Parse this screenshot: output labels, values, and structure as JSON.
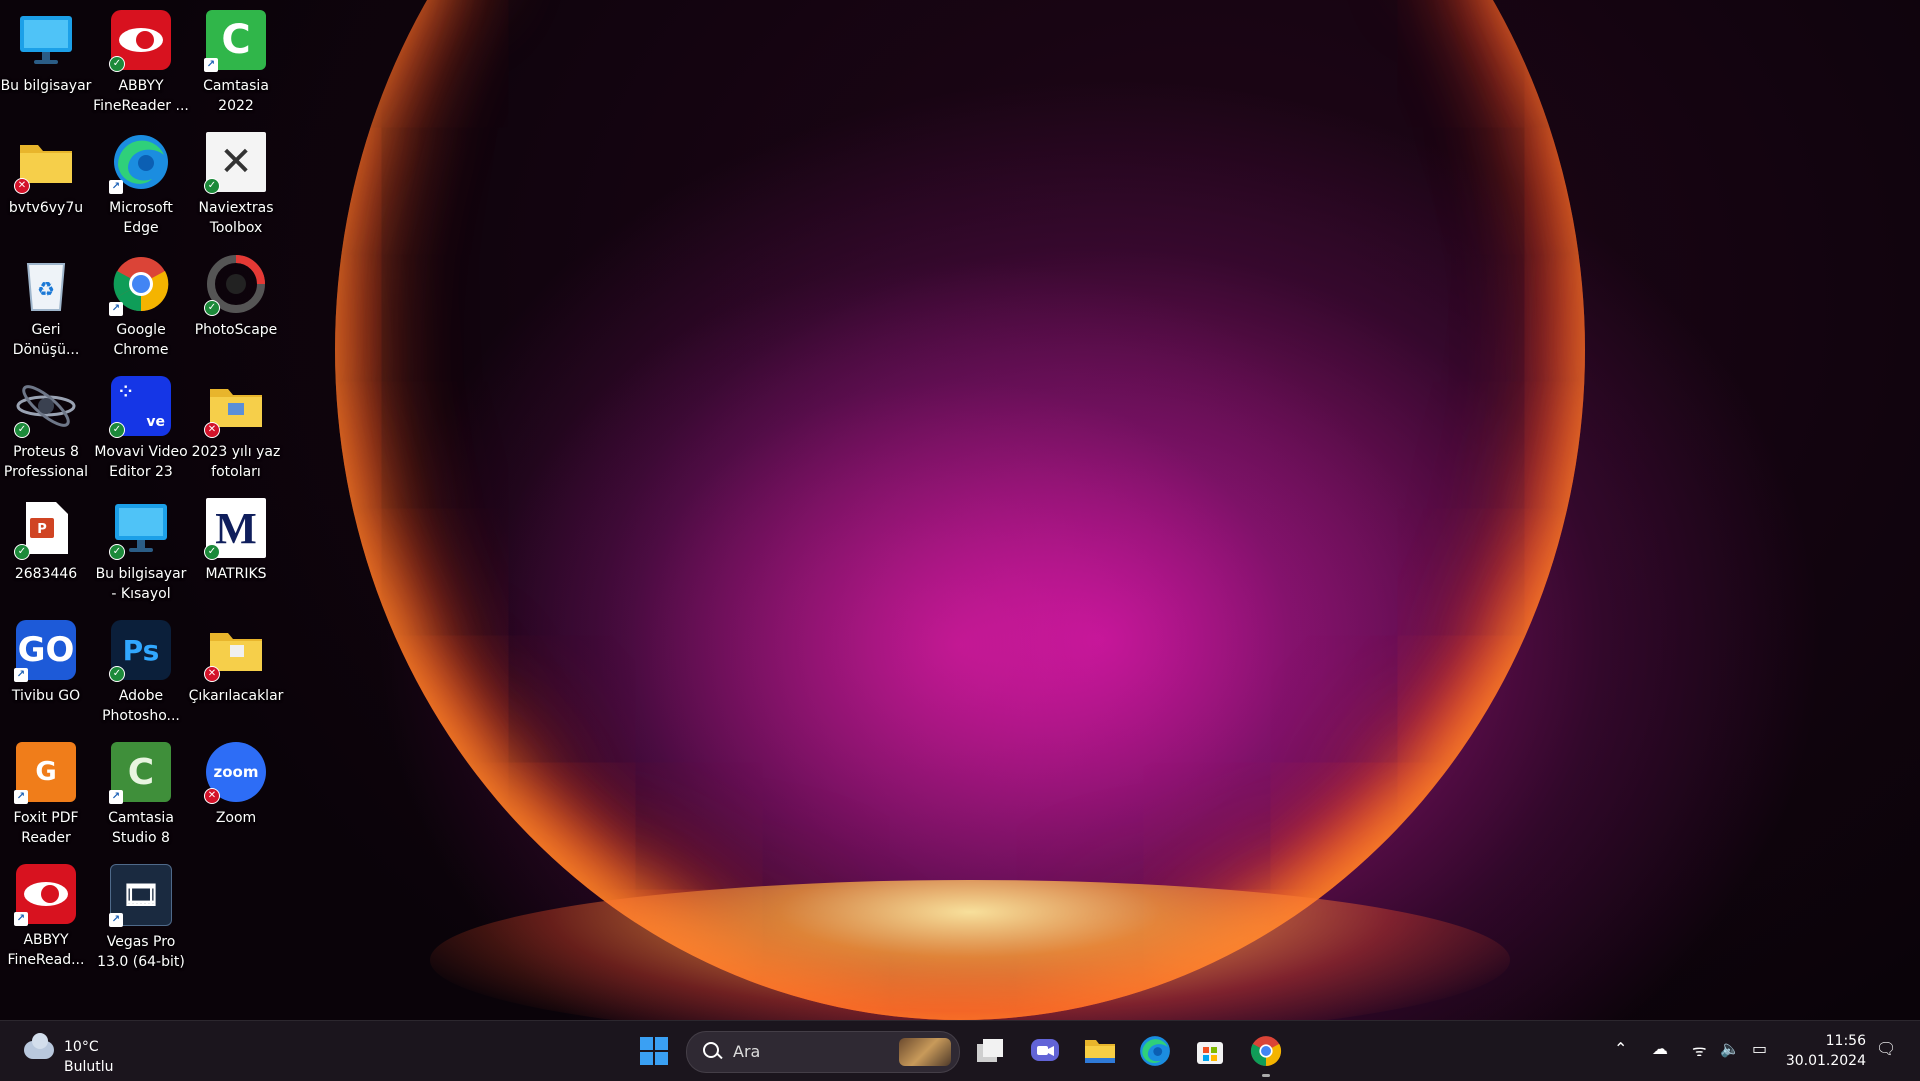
{
  "desktop": {
    "icons": [
      {
        "label": "Bu bilgisayar",
        "icon": "monitor-icon"
      },
      {
        "label": "ABBYY FineReader ...",
        "icon": "abbyy-icon"
      },
      {
        "label": "Camtasia 2022",
        "icon": "camtasia-icon"
      },
      {
        "label": "bvtv6vy7u",
        "icon": "folder-icon"
      },
      {
        "label": "Microsoft Edge",
        "icon": "edge-icon"
      },
      {
        "label": "Naviextras Toolbox",
        "icon": "naviextras-icon"
      },
      {
        "label": "Geri Dönüşü...",
        "icon": "recycle-bin-icon"
      },
      {
        "label": "Google Chrome",
        "icon": "chrome-icon"
      },
      {
        "label": "PhotoScape",
        "icon": "photoscape-icon"
      },
      {
        "label": "Proteus 8 Professional",
        "icon": "proteus-icon"
      },
      {
        "label": "Movavi Video Editor 23",
        "icon": "movavi-icon"
      },
      {
        "label": "2023 yılı yaz fotoları",
        "icon": "folder-icon"
      },
      {
        "label": "2683446",
        "icon": "powerpoint-file-icon"
      },
      {
        "label": "Bu bilgisayar - Kısayol",
        "icon": "monitor-icon"
      },
      {
        "label": "MATRIKS",
        "icon": "matriks-icon"
      },
      {
        "label": "Tivibu GO",
        "icon": "tivibu-icon"
      },
      {
        "label": "Adobe Photosho...",
        "icon": "photoshop-icon"
      },
      {
        "label": "Çıkarılacaklar",
        "icon": "folder-icon"
      },
      {
        "label": "Foxit PDF Reader",
        "icon": "foxit-icon"
      },
      {
        "label": "Camtasia Studio 8",
        "icon": "camtasia-icon"
      },
      {
        "label": "Zoom",
        "icon": "zoom-icon"
      },
      {
        "label": "ABBYY FineRead...",
        "icon": "abbyy-icon"
      },
      {
        "label": "Vegas Pro 13.0 (64-bit)",
        "icon": "vegas-icon"
      }
    ]
  },
  "taskbar": {
    "weather": {
      "temp": "10°C",
      "condition": "Bulutlu"
    },
    "search": {
      "placeholder": "Ara"
    },
    "clock": {
      "time": "11:56",
      "date": "30.01.2024"
    }
  }
}
